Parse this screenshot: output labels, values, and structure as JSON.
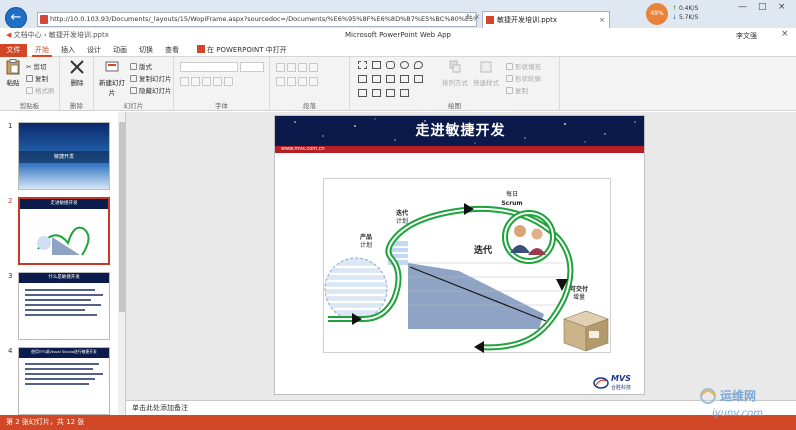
{
  "browser": {
    "url": "http://10.0.103.93/Documents/_layouts/15/WopiFrame.aspx?sourcedoc=/Documents/%E6%95%8F%E6%8D%B7%E5%BC%80%E5%8F%...",
    "tab_title": "敏捷开发培训.pptx",
    "net_percent": "49%",
    "net_up": "0.4K/S",
    "net_down": "5.7K/S"
  },
  "app": {
    "breadcrumb_root": "文档中心",
    "breadcrumb_file": "敏捷开发培训.pptx",
    "title": "Microsoft PowerPoint Web App",
    "user": "李文强"
  },
  "ribbon_tabs": [
    "文件",
    "开始",
    "插入",
    "设计",
    "动画",
    "切换",
    "查看"
  ],
  "open_in_ppt": "在 POWERPOINT 中打开",
  "ribbon": {
    "clipboard": {
      "paste": "粘贴",
      "cut": "剪切",
      "copy": "复制",
      "format_painter": "格式刷",
      "label": "剪贴板"
    },
    "delete": {
      "button": "删除",
      "label": "删除"
    },
    "slides": {
      "new": "新建幻灯片",
      "layout": "版式",
      "duplicate": "复制幻灯片",
      "hide": "隐藏幻灯片",
      "label": "幻灯片"
    },
    "font": {
      "label": "字体"
    },
    "paragraph": {
      "label": "段落"
    },
    "drawing": {
      "arrange": "排列方式",
      "quick_styles": "快速样式",
      "shape_fill": "形状填充",
      "shape_outline": "形状轮廓",
      "duplicate": "复制",
      "label": "绘图"
    }
  },
  "thumbnails": [
    {
      "num": "1",
      "title": "敏捷开发"
    },
    {
      "num": "2",
      "title": "走进敏捷开发"
    },
    {
      "num": "3",
      "title": "什么是敏捷开发"
    },
    {
      "num": "4",
      "title": "使用TFS或Visual Studio进行敏捷开发"
    }
  ],
  "slide": {
    "title": "走进敏捷开发",
    "url": "www.mvs.com.cn",
    "labels": {
      "daily": "每日",
      "scrum": "Scrum",
      "iteration": "迭代",
      "iteration_plan": "计划",
      "iteration_big": "迭代",
      "product": "产品",
      "product_plan": "计划",
      "deliverable": "可交付",
      "increment": "增量"
    },
    "logo_text": "MVS",
    "logo_sub": "合胜科技"
  },
  "notes_placeholder": "单击此处添加备注",
  "status": "第 2 张幻灯片，共 12 张",
  "watermark": {
    "cn": "运维网",
    "domain": "iyunv.com"
  },
  "colors": {
    "accent": "#d24726",
    "loop_green": "#1ea33b",
    "slide_navy": "#0b1a4a"
  }
}
